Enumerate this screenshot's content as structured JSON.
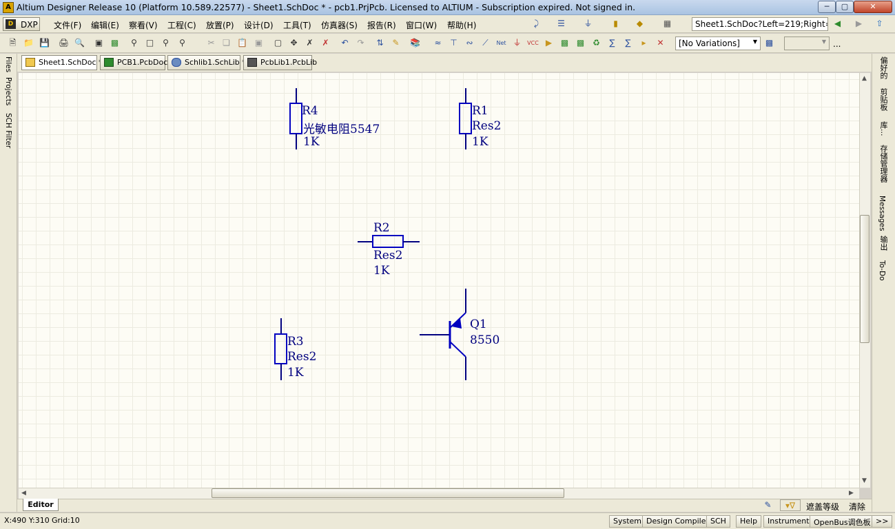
{
  "window": {
    "title": "Altium Designer Release 10 (Platform 10.589.22577) - Sheet1.SchDoc * - pcb1.PrjPcb. Licensed to ALTIUM - Subscription expired. Not signed in."
  },
  "menubar": {
    "dxp_label": "DXP",
    "items": [
      "文件(F)",
      "编辑(E)",
      "察看(V)",
      "工程(C)",
      "放置(P)",
      "设计(D)",
      "工具(T)",
      "仿真器(S)",
      "报告(R)",
      "窗口(W)",
      "帮助(H)"
    ],
    "address": "Sheet1.SchDoc?Left=219;Right="
  },
  "toolbar": {
    "variations": "[No Variations]",
    "more": "..."
  },
  "doc_tabs": [
    {
      "label": "Sheet1.SchDoc *"
    },
    {
      "label": "PCB1.PcbDoc"
    },
    {
      "label": "Schlib1.SchLib *"
    },
    {
      "label": "PcbLib1.PcbLib"
    }
  ],
  "left_panels": [
    "Files",
    "Projects",
    "SCH Filter"
  ],
  "right_panels": [
    "偏好的",
    "剪贴板",
    "库...",
    "存储管理器",
    "Messages",
    "输出",
    "To-Do"
  ],
  "schematic": {
    "components": [
      {
        "designator": "R4",
        "comment": "光敏电阻5547",
        "value": "1K"
      },
      {
        "designator": "R1",
        "comment": "Res2",
        "value": "1K"
      },
      {
        "designator": "R2",
        "comment": "Res2",
        "value": "1K"
      },
      {
        "designator": "R3",
        "comment": "Res2",
        "value": "1K"
      },
      {
        "designator": "Q1",
        "comment": "8550"
      }
    ]
  },
  "editor_tab": "Editor",
  "bottom_controls": {
    "mask_level": "遮盖等级",
    "clear": "清除"
  },
  "status": {
    "coords": "X:490 Y:310",
    "grid": "Grid:10",
    "buttons": [
      "System",
      "Design Compiler",
      "SCH",
      "Help",
      "Instruments",
      "OpenBus调色板"
    ],
    "more": ">>"
  },
  "colors": {
    "schematic_line": "#00007f",
    "component_blue": "#0000c0",
    "sheet_bg": "#fdfcf5",
    "grid": "#ecebe0"
  }
}
